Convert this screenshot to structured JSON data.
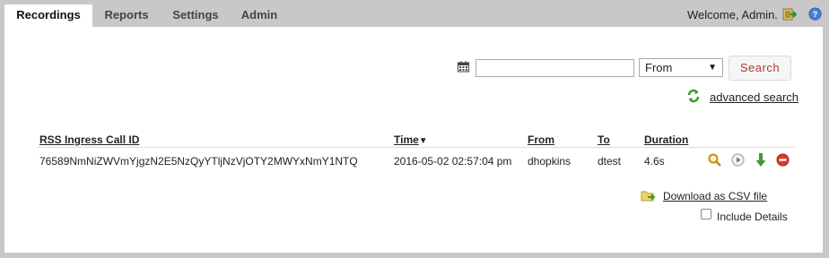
{
  "nav": {
    "tabs": [
      {
        "label": "Recordings",
        "active": true
      },
      {
        "label": "Reports",
        "active": false
      },
      {
        "label": "Settings",
        "active": false
      },
      {
        "label": "Admin",
        "active": false
      }
    ],
    "welcome": "Welcome, Admin."
  },
  "search": {
    "value": "",
    "placeholder": "",
    "field_select": "From",
    "button_label": "Search",
    "advanced_label": "advanced search"
  },
  "table": {
    "columns": [
      "RSS Ingress Call ID",
      "Time",
      "From",
      "To",
      "Duration"
    ],
    "sort_indicator": "▼",
    "rows": [
      {
        "call_id": "76589NmNiZWVmYjgzN2E5NzQyYTljNzVjOTY2MWYxNmY1NTQ",
        "time": "2016-05-02 02:57:04 pm",
        "from": "dhopkins",
        "to": "dtest",
        "duration": "4.6s"
      }
    ]
  },
  "footer": {
    "csv_label": "Download as CSV file",
    "include_details_label": "Include Details",
    "include_details_checked": false
  },
  "colors": {
    "chrome_bg": "#c8c8c8",
    "search_text": "#b03a2e"
  }
}
